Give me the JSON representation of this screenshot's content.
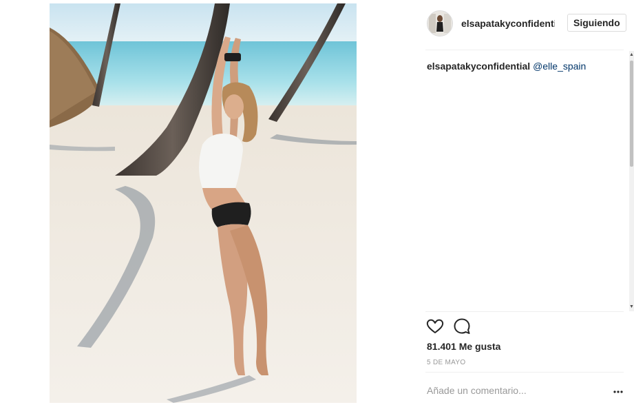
{
  "post": {
    "username": "elsapatakyconfidential",
    "follow_label": "Siguiendo",
    "caption": {
      "user": "elsapatakyconfidential",
      "mention": "@elle_spain"
    },
    "likes": "81.401 Me gusta",
    "date": "5 DE MAYO",
    "comment_placeholder": "Añade un comentario..."
  },
  "icons": {
    "like": "heart-icon",
    "comment": "comment-icon",
    "more": "more-options-icon"
  },
  "colors": {
    "text": "#262626",
    "mention": "#003569",
    "muted": "#999999",
    "border": "#dbdbdb"
  }
}
